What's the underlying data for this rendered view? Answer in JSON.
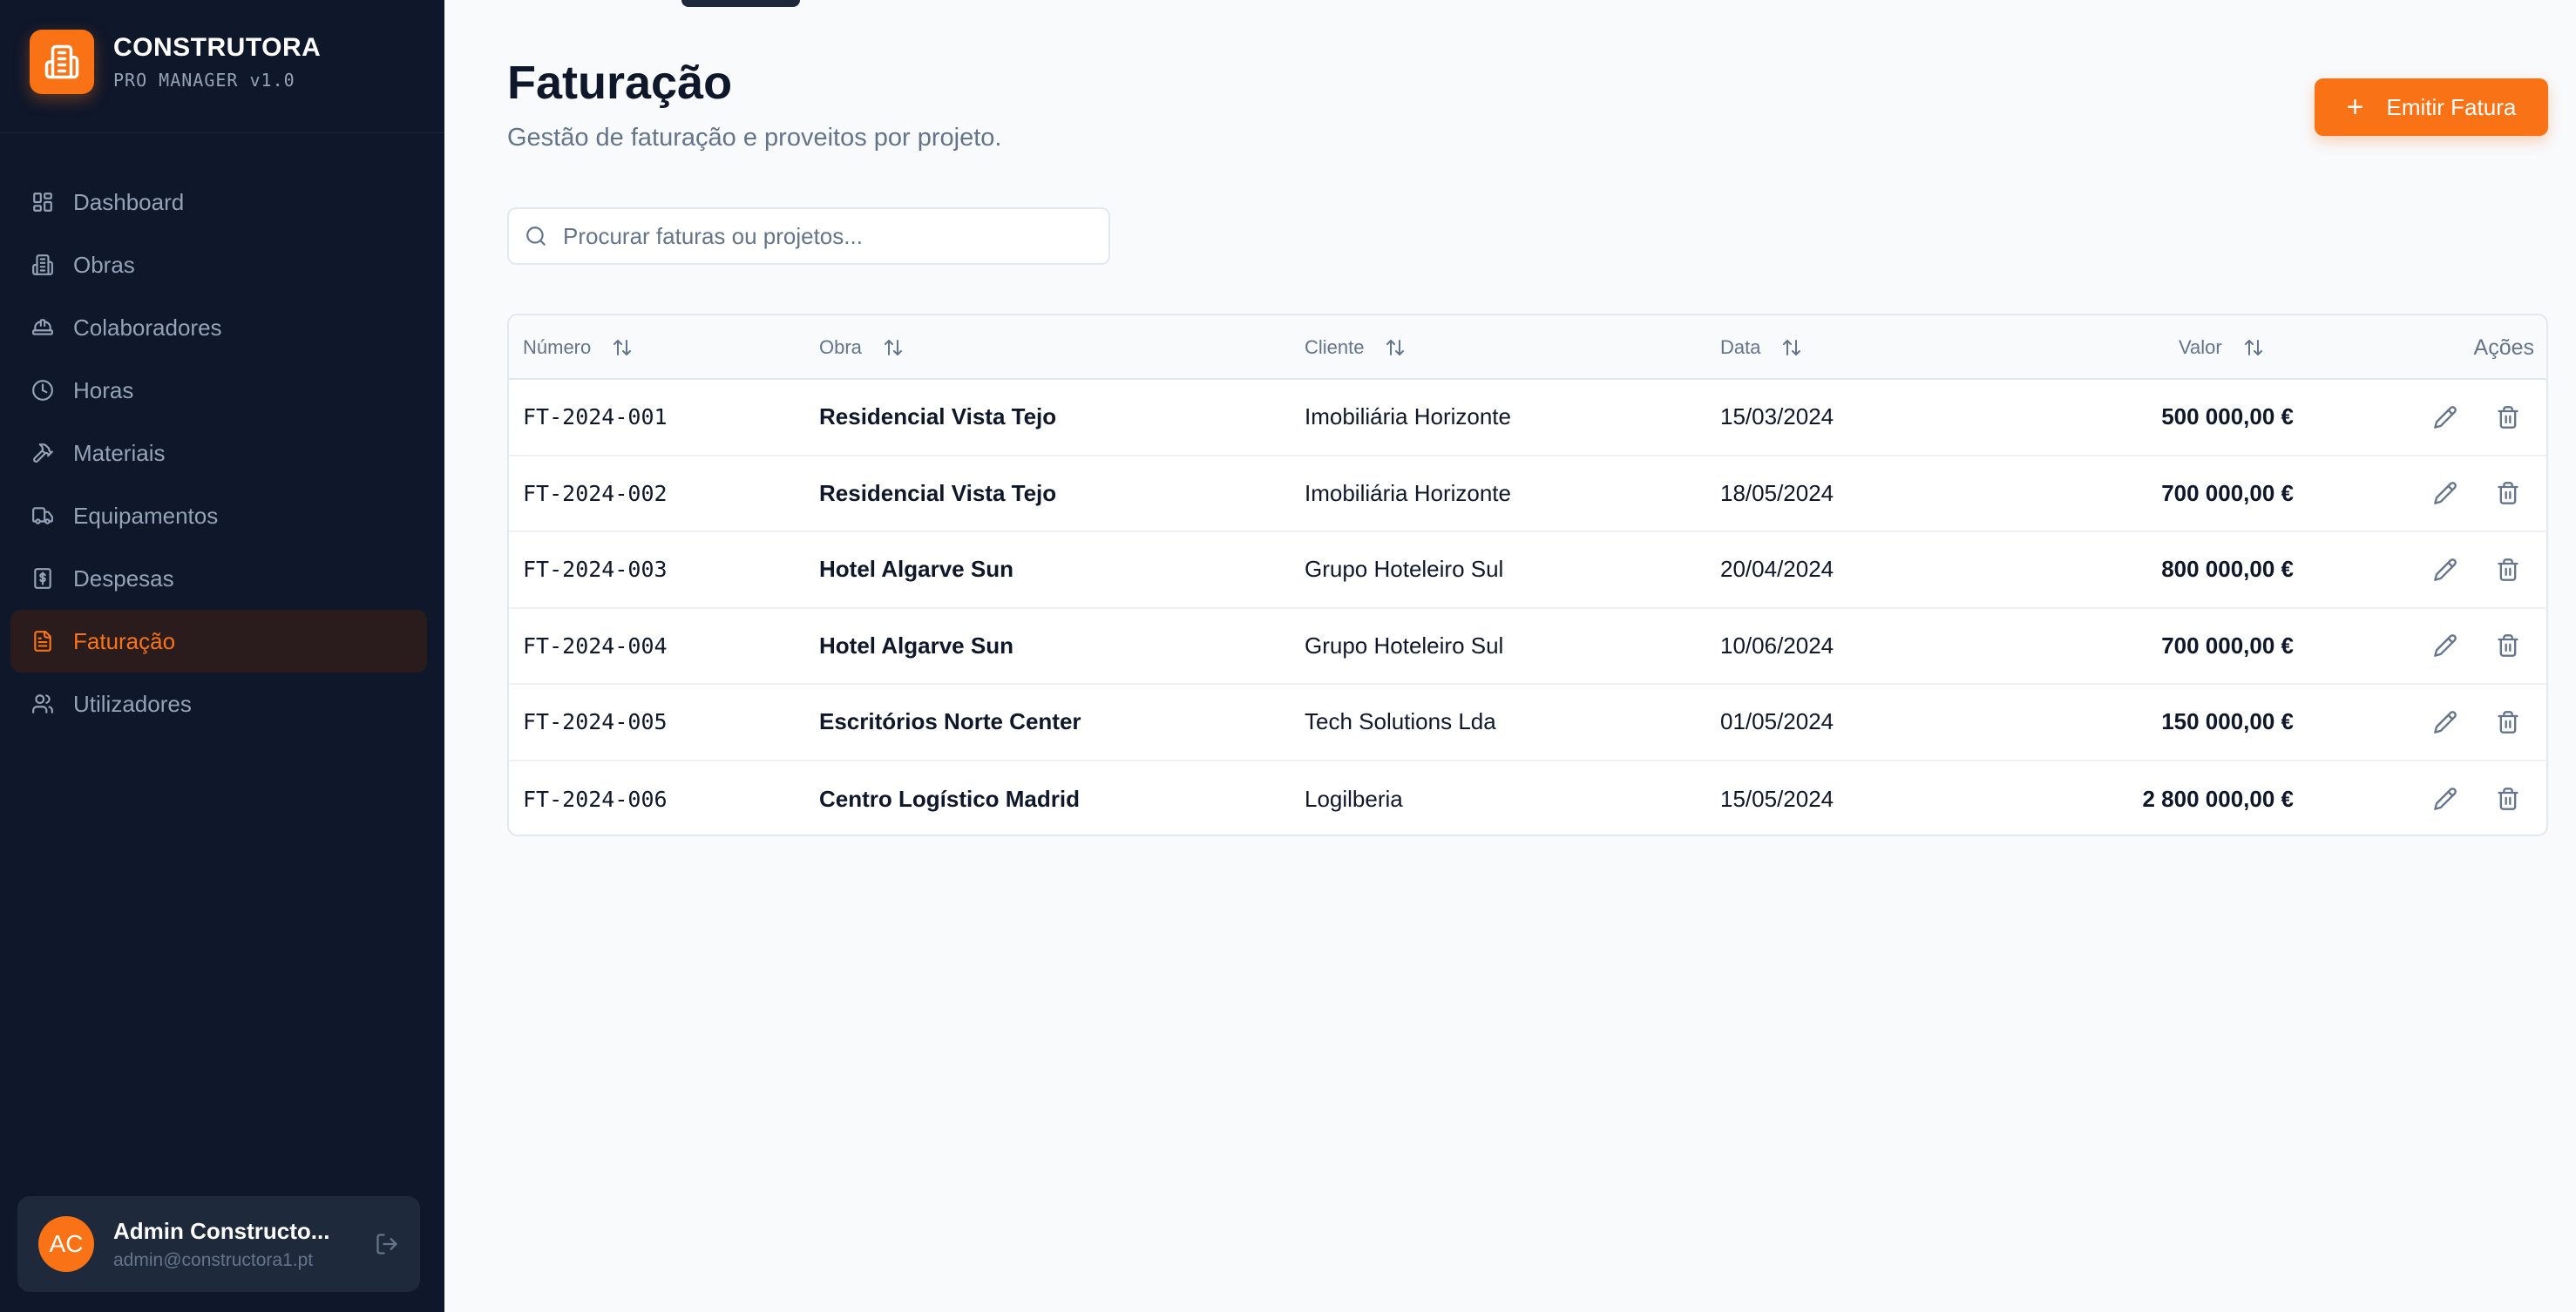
{
  "brand": {
    "name": "CONSTRUTORA",
    "subtitle": "PRO MANAGER v1.0"
  },
  "nav": [
    {
      "label": "Dashboard",
      "icon": "dashboard-icon"
    },
    {
      "label": "Obras",
      "icon": "building-icon"
    },
    {
      "label": "Colaboradores",
      "icon": "hardhat-icon"
    },
    {
      "label": "Horas",
      "icon": "clock-icon"
    },
    {
      "label": "Materiais",
      "icon": "hammer-icon"
    },
    {
      "label": "Equipamentos",
      "icon": "truck-icon"
    },
    {
      "label": "Despesas",
      "icon": "receipt-icon"
    },
    {
      "label": "Faturação",
      "icon": "file-text-icon",
      "active": true
    },
    {
      "label": "Utilizadores",
      "icon": "users-icon"
    }
  ],
  "user": {
    "initials": "AC",
    "name": "Admin Constructo...",
    "email": "admin@constructora1.pt"
  },
  "page": {
    "title": "Faturação",
    "subtitle": "Gestão de faturação e proveitos por projeto.",
    "emit_label": "Emitir Fatura"
  },
  "search": {
    "placeholder": "Procurar faturas ou projetos...",
    "value": ""
  },
  "table": {
    "headers": {
      "numero": "Número",
      "obra": "Obra",
      "cliente": "Cliente",
      "data": "Data",
      "valor": "Valor",
      "acoes": "Ações"
    },
    "rows": [
      {
        "numero": "FT-2024-001",
        "obra": "Residencial Vista Tejo",
        "cliente": "Imobiliária Horizonte",
        "data": "15/03/2024",
        "valor": "500 000,00 €"
      },
      {
        "numero": "FT-2024-002",
        "obra": "Residencial Vista Tejo",
        "cliente": "Imobiliária Horizonte",
        "data": "18/05/2024",
        "valor": "700 000,00 €"
      },
      {
        "numero": "FT-2024-003",
        "obra": "Hotel Algarve Sun",
        "cliente": "Grupo Hoteleiro Sul",
        "data": "20/04/2024",
        "valor": "800 000,00 €"
      },
      {
        "numero": "FT-2024-004",
        "obra": "Hotel Algarve Sun",
        "cliente": "Grupo Hoteleiro Sul",
        "data": "10/06/2024",
        "valor": "700 000,00 €"
      },
      {
        "numero": "FT-2024-005",
        "obra": "Escritórios Norte Center",
        "cliente": "Tech Solutions Lda",
        "data": "01/05/2024",
        "valor": "150 000,00 €"
      },
      {
        "numero": "FT-2024-006",
        "obra": "Centro Logístico Madrid",
        "cliente": "Logilberia",
        "data": "15/05/2024",
        "valor": "2 800 000,00 €"
      }
    ]
  },
  "colors": {
    "accent": "#f97316",
    "sidebar_bg": "#0f172a",
    "page_bg": "#f8fafc"
  }
}
